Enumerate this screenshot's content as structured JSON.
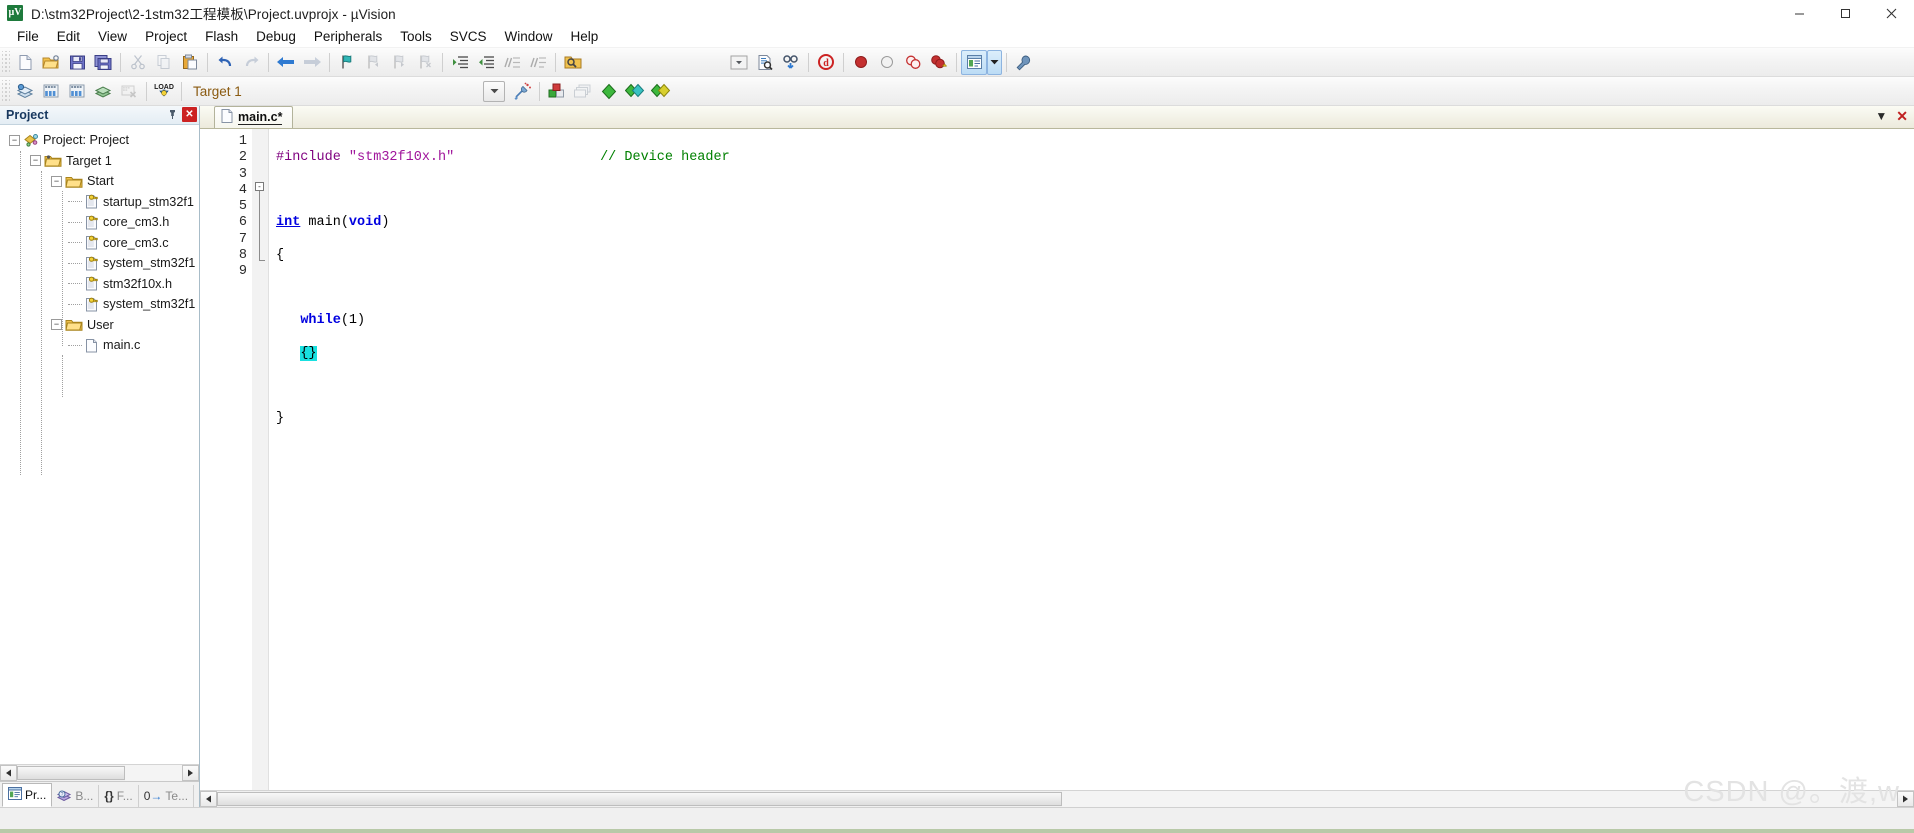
{
  "window": {
    "title": "D:\\stm32Project\\2-1stm32工程模板\\Project.uvprojx - µVision",
    "app_icon": "uvision-icon",
    "minimize_label": "Minimize",
    "maximize_label": "Maximize",
    "close_label": "Close"
  },
  "menubar": {
    "items": [
      {
        "label": "File"
      },
      {
        "label": "Edit"
      },
      {
        "label": "View"
      },
      {
        "label": "Project"
      },
      {
        "label": "Flash"
      },
      {
        "label": "Debug"
      },
      {
        "label": "Peripherals"
      },
      {
        "label": "Tools"
      },
      {
        "label": "SVCS"
      },
      {
        "label": "Window"
      },
      {
        "label": "Help"
      }
    ]
  },
  "toolbar_file": {
    "groups": [
      {
        "buttons": [
          {
            "name": "new-file-icon",
            "tip": "New"
          },
          {
            "name": "open-file-icon",
            "tip": "Open"
          },
          {
            "name": "save-icon",
            "tip": "Save"
          },
          {
            "name": "save-all-icon",
            "tip": "Save All"
          }
        ]
      },
      {
        "buttons": [
          {
            "name": "cut-icon",
            "tip": "Cut"
          },
          {
            "name": "copy-icon",
            "tip": "Copy"
          },
          {
            "name": "paste-icon",
            "tip": "Paste"
          }
        ]
      },
      {
        "buttons": [
          {
            "name": "undo-icon",
            "tip": "Undo"
          },
          {
            "name": "redo-icon",
            "tip": "Redo"
          }
        ]
      },
      {
        "buttons": [
          {
            "name": "navigate-back-icon",
            "tip": "Back"
          },
          {
            "name": "navigate-forward-icon",
            "tip": "Forward"
          }
        ]
      },
      {
        "buttons": [
          {
            "name": "bookmark-toggle-icon",
            "tip": "Insert/Remove Bookmark"
          },
          {
            "name": "bookmark-prev-icon",
            "tip": "Previous Bookmark"
          },
          {
            "name": "bookmark-next-icon",
            "tip": "Next Bookmark"
          },
          {
            "name": "bookmark-clear-icon",
            "tip": "Clear All Bookmarks"
          }
        ]
      },
      {
        "buttons": [
          {
            "name": "indent-increase-icon",
            "tip": "Indent"
          },
          {
            "name": "indent-decrease-icon",
            "tip": "Outdent"
          },
          {
            "name": "comment-icon",
            "tip": "Comment"
          },
          {
            "name": "uncomment-icon",
            "tip": "Uncomment"
          }
        ]
      },
      {
        "buttons": [
          {
            "name": "find-in-files-icon",
            "tip": "Find in Files"
          }
        ]
      }
    ],
    "right_group": [
      {
        "name": "combo-dropdown-icon",
        "tip": "Browse list"
      },
      {
        "name": "find-text-icon",
        "tip": "Find"
      },
      {
        "name": "browse-symbol-icon",
        "tip": "Go to definition"
      },
      {
        "name": "debug-session-icon",
        "tip": "Start/Stop Debug Session"
      },
      {
        "name": "breakpoint-insert-icon",
        "tip": "Insert/Remove Breakpoint"
      },
      {
        "name": "breakpoint-disable-icon",
        "tip": "Enable/Disable Breakpoint"
      },
      {
        "name": "breakpoint-disable-all-icon",
        "tip": "Disable All Breakpoints"
      },
      {
        "name": "breakpoint-kill-all-icon",
        "tip": "Kill All Breakpoints"
      },
      {
        "name": "project-window-icon",
        "tip": "Project Window"
      },
      {
        "name": "project-window-dropdown-icon",
        "tip": "Project Window options"
      },
      {
        "name": "configuration-wizard-icon",
        "tip": "Configure"
      }
    ]
  },
  "toolbar_build": {
    "left_buttons": [
      {
        "name": "translate-icon",
        "tip": "Translate"
      },
      {
        "name": "build-target-icon",
        "tip": "Build"
      },
      {
        "name": "rebuild-all-icon",
        "tip": "Rebuild"
      },
      {
        "name": "batch-build-icon",
        "tip": "Batch Build"
      },
      {
        "name": "stop-build-icon",
        "tip": "Stop Build"
      },
      {
        "name": "download-icon",
        "tip": "Download",
        "glyph": "LOAD"
      }
    ],
    "target_selector": {
      "value": "Target 1",
      "dropdown_icon": "chevron-down-icon"
    },
    "right_buttons": [
      {
        "name": "options-target-icon",
        "tip": "Options for Target"
      },
      {
        "name": "manage-project-items-icon",
        "tip": "Manage Project Items"
      },
      {
        "name": "pack-installer-icon",
        "tip": "Pack Installer"
      },
      {
        "name": "multi-project-icon",
        "tip": "Manage Multi-Project"
      },
      {
        "name": "select-software-packs-icon",
        "tip": "Select Software Packs"
      }
    ]
  },
  "project_panel": {
    "title": "Project",
    "pin_icon": "pin-icon",
    "close_icon": "close-icon",
    "tree": [
      {
        "level": 0,
        "label": "Project: Project",
        "icon": "project-icon",
        "expander": "-"
      },
      {
        "level": 1,
        "label": "Target 1",
        "icon": "target-folder-icon",
        "expander": "-"
      },
      {
        "level": 2,
        "label": "Start",
        "icon": "folder-icon",
        "expander": "-"
      },
      {
        "level": 3,
        "label": "startup_stm32f1",
        "icon": "source-file-key-icon",
        "expander": ""
      },
      {
        "level": 3,
        "label": "core_cm3.h",
        "icon": "source-file-key-icon",
        "expander": ""
      },
      {
        "level": 3,
        "label": "core_cm3.c",
        "icon": "source-file-key-icon",
        "expander": ""
      },
      {
        "level": 3,
        "label": "system_stm32f1",
        "icon": "source-file-key-icon",
        "expander": ""
      },
      {
        "level": 3,
        "label": "stm32f10x.h",
        "icon": "source-file-key-icon",
        "expander": ""
      },
      {
        "level": 3,
        "label": "system_stm32f1",
        "icon": "source-file-key-icon",
        "expander": ""
      },
      {
        "level": 2,
        "label": "User",
        "icon": "folder-icon",
        "expander": "-"
      },
      {
        "level": 3,
        "label": "main.c",
        "icon": "plain-file-icon",
        "expander": ""
      }
    ],
    "bottom_tabs": [
      {
        "label": "Pr...",
        "icon": "project-tab-icon",
        "selected": true
      },
      {
        "label": "B...",
        "icon": "books-tab-icon",
        "selected": false
      },
      {
        "label": "F...",
        "icon": "functions-tab-icon",
        "selected": false
      },
      {
        "label": "Te...",
        "icon": "templates-tab-icon",
        "selected": false
      }
    ],
    "scroll_left_icon": "scroll-left-arrow",
    "scroll_right_icon": "scroll-right-arrow"
  },
  "editor": {
    "tabs": [
      {
        "label": "main.c*",
        "icon": "source-doc-icon",
        "active": true
      }
    ],
    "tab_controls": [
      {
        "name": "tab-list-dropdown-icon",
        "glyph": "▼"
      },
      {
        "name": "tab-close-icon",
        "glyph": "✕"
      }
    ],
    "line_numbers": [
      "1",
      "2",
      "3",
      "4",
      "5",
      "6",
      "7",
      "8",
      "9"
    ],
    "code_lines": [
      {
        "n": 1,
        "tokens": [
          {
            "t": "#include ",
            "c": "k-pre"
          },
          {
            "t": "\"stm32f10x.h\"",
            "c": "k-str"
          },
          {
            "t": "                  ",
            "c": ""
          },
          {
            "t": "// Device header",
            "c": "k-cmt"
          }
        ]
      },
      {
        "n": 2,
        "tokens": []
      },
      {
        "n": 3,
        "tokens": [
          {
            "t": "int",
            "c": "k-kwu"
          },
          {
            "t": " main(",
            "c": ""
          },
          {
            "t": "void",
            "c": "k-kw"
          },
          {
            "t": ")",
            "c": ""
          }
        ]
      },
      {
        "n": 4,
        "tokens": [
          {
            "t": "{",
            "c": ""
          }
        ]
      },
      {
        "n": 5,
        "tokens": []
      },
      {
        "n": 6,
        "tokens": [
          {
            "t": "   ",
            "c": ""
          },
          {
            "t": "while",
            "c": "k-kw"
          },
          {
            "t": "(1)",
            "c": ""
          }
        ]
      },
      {
        "n": 7,
        "tokens": [
          {
            "t": "   ",
            "c": ""
          },
          {
            "t": "{}",
            "c": "k-hl"
          }
        ]
      },
      {
        "n": 8,
        "tokens": []
      },
      {
        "n": 9,
        "tokens": [
          {
            "t": "}",
            "c": ""
          }
        ]
      }
    ],
    "fold_markers": [
      {
        "line": 4,
        "glyph": "-"
      }
    ]
  },
  "watermark": {
    "text": "CSDN @。渡,w"
  },
  "colors": {
    "preprocessor": "#7f007f",
    "string": "#a0159b",
    "comment": "#008000",
    "keyword": "#0000e0",
    "highlight": "#19e0e0",
    "panel_title": "#17375e",
    "target_text": "#8a5a10",
    "accent_bottom": "#b8c9a8"
  }
}
